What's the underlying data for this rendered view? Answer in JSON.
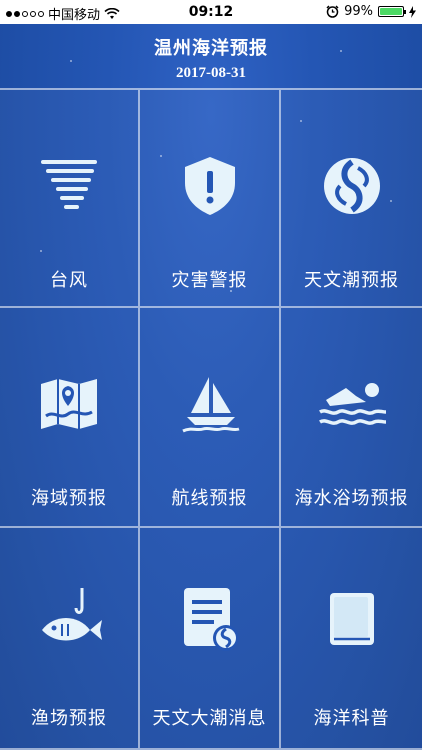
{
  "status_bar": {
    "carrier": "中国移动",
    "time": "09:12",
    "battery": "99%",
    "battery_level": 0.99
  },
  "header": {
    "title": "温州海洋预报",
    "date": "2017-08-31"
  },
  "tiles": [
    {
      "label": "台风",
      "icon": "typhoon-icon"
    },
    {
      "label": "灾害警报",
      "icon": "warning-shield-icon"
    },
    {
      "label": "天文潮预报",
      "icon": "tide-swirl-icon"
    },
    {
      "label": "海域预报",
      "icon": "map-pin-icon"
    },
    {
      "label": "航线预报",
      "icon": "sailboat-icon"
    },
    {
      "label": "海水浴场预报",
      "icon": "swimmer-icon"
    },
    {
      "label": "渔场预报",
      "icon": "fish-hook-icon"
    },
    {
      "label": "天文大潮消息",
      "icon": "document-icon"
    },
    {
      "label": "海洋科普",
      "icon": "book-icon"
    }
  ],
  "colors": {
    "background": "#2456b4",
    "icon_fill": "#e6f3fb",
    "battery_green": "#4cd964"
  }
}
